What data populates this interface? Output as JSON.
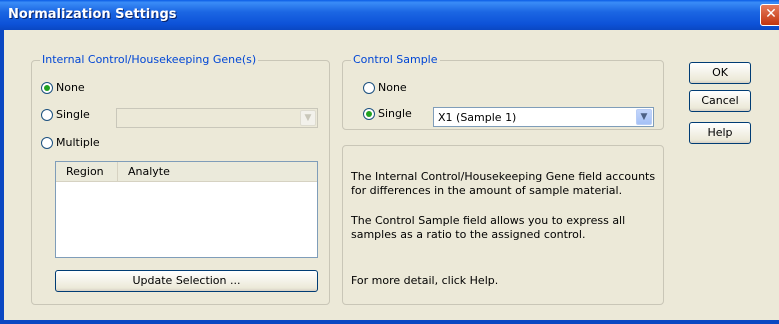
{
  "window": {
    "title": "Normalization Settings",
    "close_glyph": "✕"
  },
  "internal_control": {
    "group_label": "Internal Control/Housekeeping Gene(s)",
    "options": [
      {
        "label": "None",
        "checked": true
      },
      {
        "label": "Single",
        "checked": false
      },
      {
        "label": "Multiple",
        "checked": false
      }
    ],
    "single_combo_value": "",
    "table_columns": [
      "Region",
      "Analyte"
    ],
    "update_button": "Update Selection ..."
  },
  "control_sample": {
    "group_label": "Control Sample",
    "options": [
      {
        "label": "None",
        "checked": false
      },
      {
        "label": "Single",
        "checked": true
      }
    ],
    "single_combo_value": "X1 (Sample 1)"
  },
  "info": {
    "para1_line1": "The Internal Control/Housekeeping Gene field accounts",
    "para1_line2": "for differences in the amount of sample material.",
    "para2_line1": "The Control Sample field allows you to express all",
    "para2_line2": "samples as a ratio to the assigned control.",
    "para3": "For more detail, click Help."
  },
  "buttons": {
    "ok": "OK",
    "cancel": "Cancel",
    "help": "Help"
  },
  "colors": {
    "group_label": "#0046d5",
    "titlebar": "#0a5ce6",
    "radio_checked": "#21a121"
  }
}
